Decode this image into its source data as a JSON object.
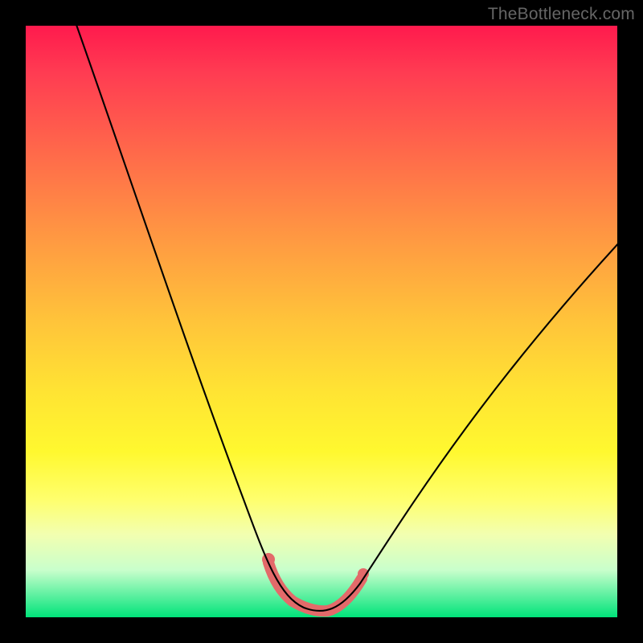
{
  "watermark": "TheBottleneck.com",
  "colors": {
    "frame": "#000000",
    "curve": "#000000",
    "accent": "#e36a6a",
    "gradient_top": "#ff1a4d",
    "gradient_bottom": "#00e37a"
  },
  "chart_data": {
    "type": "line",
    "title": "",
    "xlabel": "",
    "ylabel": "",
    "xlim": [
      0,
      100
    ],
    "ylim": [
      0,
      100
    ],
    "grid": false,
    "legend": false,
    "series": [
      {
        "name": "bottleneck-curve",
        "x": [
          0,
          4,
          8,
          12,
          16,
          20,
          24,
          28,
          32,
          36,
          40,
          44,
          46,
          48,
          50,
          52,
          54,
          58,
          64,
          72,
          80,
          88,
          96,
          100
        ],
        "y": [
          100,
          92,
          84,
          76,
          68,
          60,
          51,
          43,
          35,
          27,
          18,
          9,
          5,
          2,
          1,
          1,
          2,
          6,
          14,
          26,
          38,
          49,
          59,
          64
        ]
      }
    ],
    "accent_segment": {
      "name": "minimum-highlight",
      "x": [
        42,
        44,
        46,
        48,
        50,
        52,
        54,
        56
      ],
      "y": [
        11,
        6,
        3,
        1.5,
        1,
        1.5,
        3,
        6
      ]
    },
    "notes": "y-axis inverted visually (0 at bottom = green/good, 100 at top = red/bad). Values are estimated from the rendered curve; no numeric axis labels are shown in the image."
  }
}
